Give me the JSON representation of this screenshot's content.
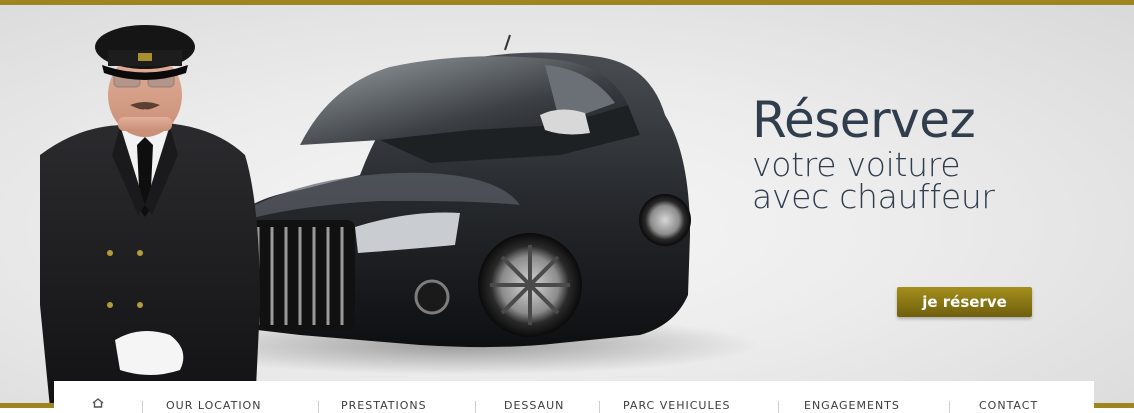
{
  "hero": {
    "headline": "Réservez",
    "subline_1": "votre voiture",
    "subline_2": "avec chauffeur",
    "cta_label": "je réserve"
  },
  "nav": {
    "items": [
      {
        "label": "",
        "icon": "home-icon"
      },
      {
        "label": "OUR LOCATION"
      },
      {
        "label": "PRESTATIONS"
      },
      {
        "label": "DESSAUN"
      },
      {
        "label": "PARC VEHICULES"
      },
      {
        "label": "ENGAGEMENTS"
      },
      {
        "label": "CONTACT"
      }
    ]
  },
  "colors": {
    "accent_gold": "#9d8620",
    "headline_text": "#2f3d4c",
    "button_gradient_top": "#a48f1c",
    "button_gradient_bottom": "#6f5f0d"
  }
}
